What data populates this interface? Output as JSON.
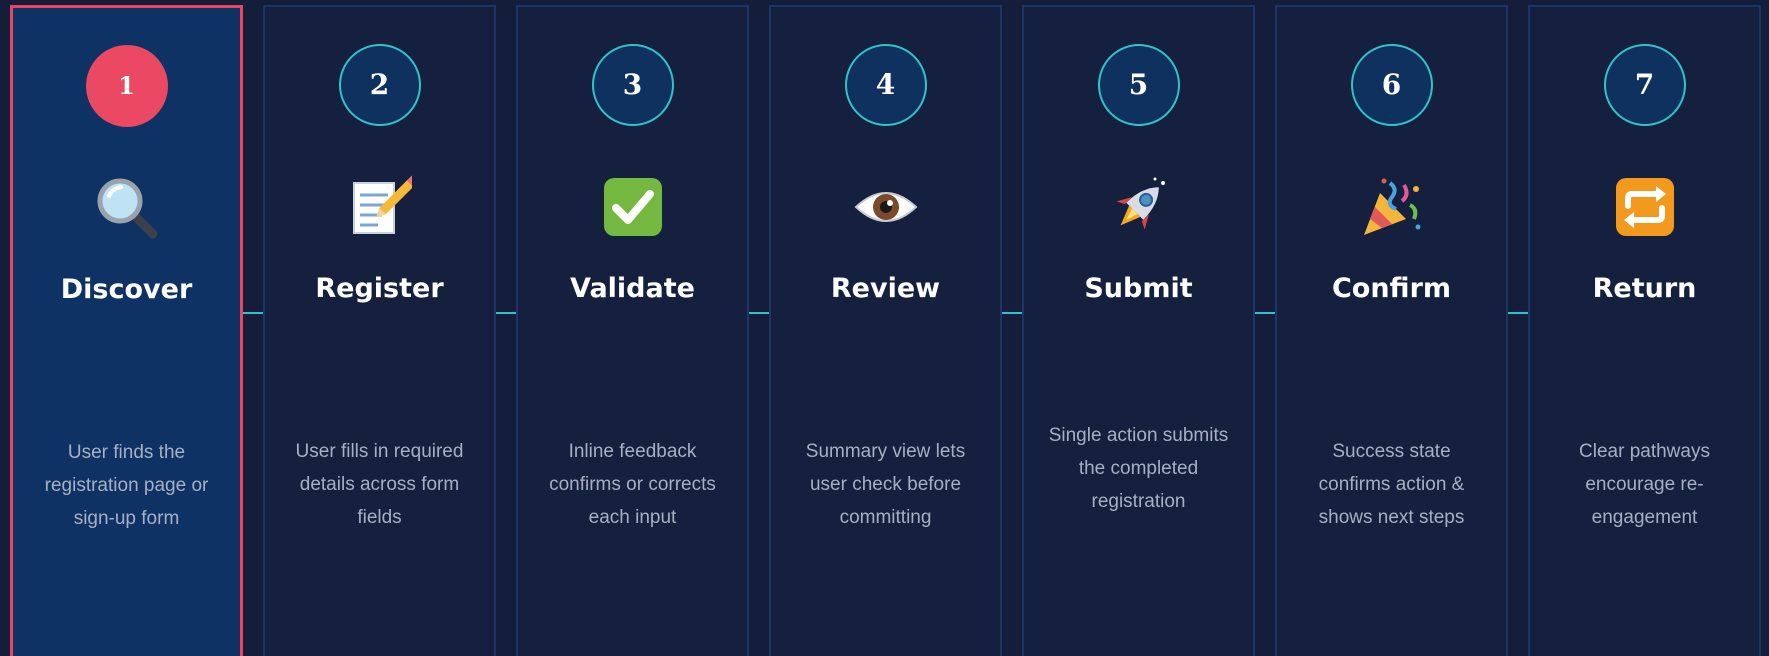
{
  "steps": [
    {
      "number": "1",
      "title": "Discover",
      "icon": "magnifying-glass-icon",
      "desc": "User finds the registration page or sign-up form"
    },
    {
      "number": "2",
      "title": "Register",
      "icon": "memo-pencil-icon",
      "desc": "User fills in required details across form fields"
    },
    {
      "number": "3",
      "title": "Validate",
      "icon": "check-mark-button-icon",
      "desc": "Inline feedback confirms or corrects each input"
    },
    {
      "number": "4",
      "title": "Review",
      "icon": "eye-icon",
      "desc": "Summary view lets user check before committing"
    },
    {
      "number": "5",
      "title": "Submit",
      "icon": "rocket-icon",
      "desc": "Single action submits the completed registration"
    },
    {
      "number": "6",
      "title": "Confirm",
      "icon": "party-popper-icon",
      "desc": "Success state confirms action & shows next steps"
    },
    {
      "number": "7",
      "title": "Return",
      "icon": "repeat-arrows-icon",
      "desc": "Clear pathways encourage re-engagement"
    }
  ],
  "active_step": "1",
  "colors": {
    "background": "#141d3a",
    "card": "#151f3e",
    "card_active": "#0f3264",
    "accent_active": "#ea4863",
    "accent": "#2ec4c8",
    "text": "#ffffff",
    "muted_text": "#a6b0c2"
  }
}
